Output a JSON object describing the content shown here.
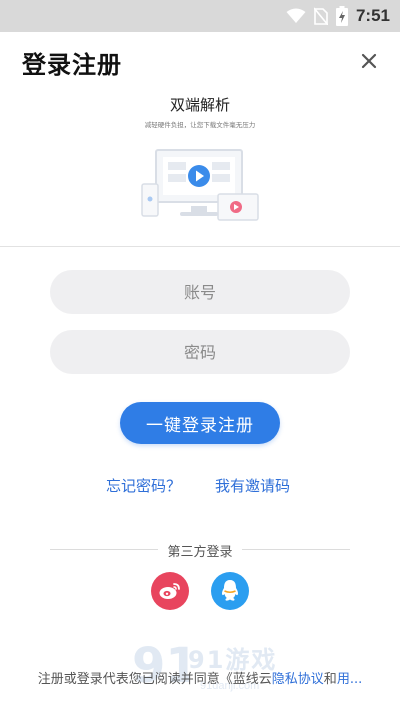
{
  "status_bar": {
    "time": "7:51",
    "icons": [
      "wifi-icon",
      "no-sim-icon",
      "battery-charging-icon"
    ]
  },
  "header": {
    "title": "登录注册",
    "close_icon": "close-icon"
  },
  "banner": {
    "title": "双端解析",
    "subtitle": "减轻硬件负担，让您下载文件毫无压力"
  },
  "form": {
    "account_placeholder": "账号",
    "password_placeholder": "密码",
    "login_button": "一键登录注册",
    "forgot_link": "忘记密码？",
    "invite_link": "我有邀请码"
  },
  "third_party": {
    "label": "第三方登录",
    "providers": [
      {
        "name": "weibo",
        "icon": "weibo-icon",
        "color": "#e8455e"
      },
      {
        "name": "qq",
        "icon": "qq-icon",
        "color": "#2b9ef0"
      }
    ]
  },
  "footer": {
    "prefix": "注册或登录代表您已阅读并同意《蓝线云",
    "privacy_link": "隐私协议",
    "and": "和",
    "terms_link": "用..."
  },
  "watermark": {
    "logo_text": "91游戏",
    "url": "91danji.com"
  },
  "colors": {
    "accent": "#2f7de6",
    "link": "#2f6fd8",
    "weibo": "#e8455e",
    "qq": "#2b9ef0",
    "status_bar": "#d9d9d9"
  }
}
